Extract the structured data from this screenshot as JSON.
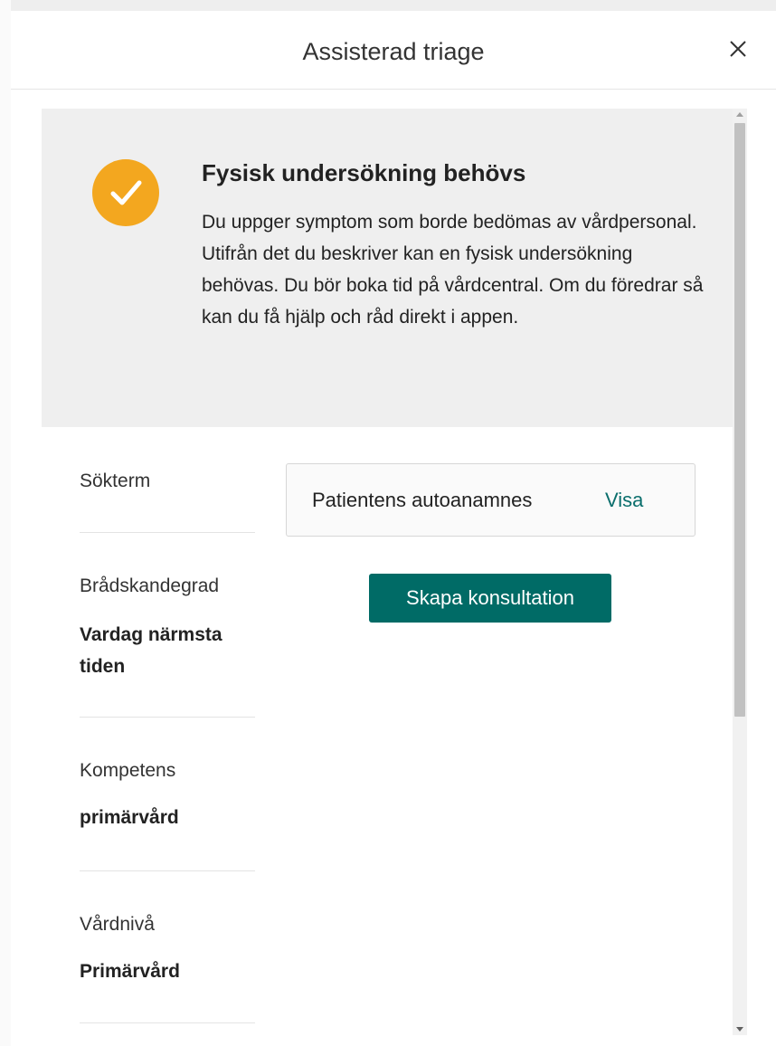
{
  "modal": {
    "title": "Assisterad triage",
    "close_icon": "close-icon"
  },
  "result": {
    "icon": "check-circle-icon",
    "icon_color": "#f3a71f",
    "title": "Fysisk undersökning behövs",
    "description": "Du uppger symptom som borde bedömas av vårdpersonal. Utifrån det du beskriver kan en fysisk undersökning behövas. Du bör boka tid på vårdcentral. Om du föredrar så kan du få hjälp och råd direkt i appen."
  },
  "info": [
    {
      "label": "Sökterm",
      "value": ""
    },
    {
      "label": "Brådskandegrad",
      "value": "Vardag närmsta tiden"
    },
    {
      "label": "Kompetens",
      "value": "primärvård"
    },
    {
      "label": "Vårdnivå",
      "value": "Primärvård"
    }
  ],
  "anamnes": {
    "label": "Patientens autoanamnes",
    "link": "Visa"
  },
  "actions": {
    "create_consultation": "Skapa konsultation"
  },
  "colors": {
    "accent": "#006b66",
    "link": "#0a6e6c",
    "result_bg": "#efefef"
  }
}
